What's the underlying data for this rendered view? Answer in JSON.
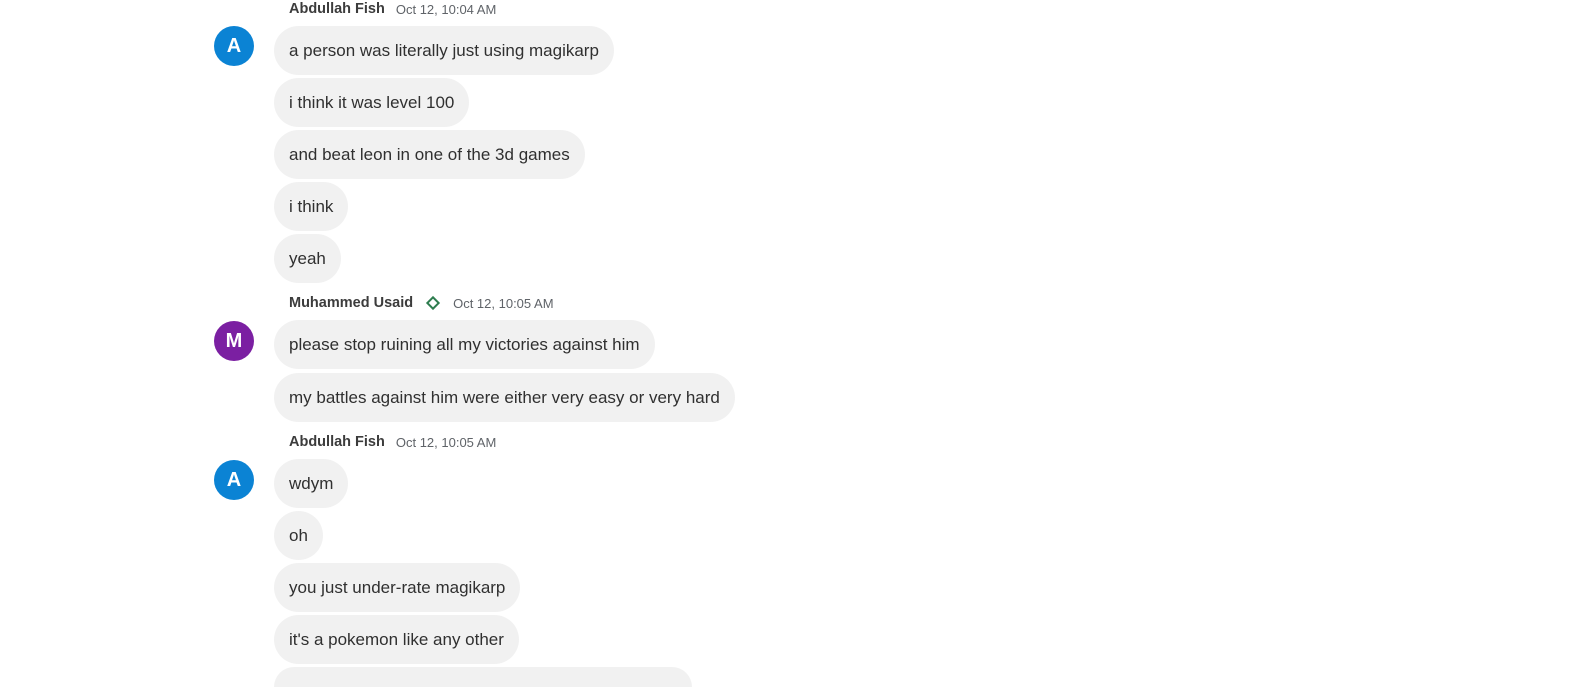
{
  "colors": {
    "avatar_a": "#0b83d4",
    "avatar_m": "#7b1fa2",
    "bubble_bg": "#f1f1f1",
    "badge": "#2e7d4f"
  },
  "groups": [
    {
      "avatar_letter": "A",
      "sender": "Abdullah Fish",
      "time": "Oct 12, 10:04 AM",
      "messages": [
        "a person was literally just using magikarp",
        "i think it was level 100",
        "and beat leon in one of the 3d games",
        "i think",
        "yeah"
      ]
    },
    {
      "avatar_letter": "M",
      "sender": "Muhammed Usaid",
      "badge_icon": "diamond-icon",
      "time": "Oct 12, 10:05 AM",
      "messages": [
        "please stop ruining all my victories against him",
        "my battles against him were either very easy or very hard"
      ]
    },
    {
      "avatar_letter": "A",
      "sender": "Abdullah Fish",
      "time": "Oct 12, 10:05 AM",
      "messages": [
        "wdym",
        "oh",
        "you just under-rate magikarp",
        "it's a pokemon like any other"
      ]
    }
  ]
}
